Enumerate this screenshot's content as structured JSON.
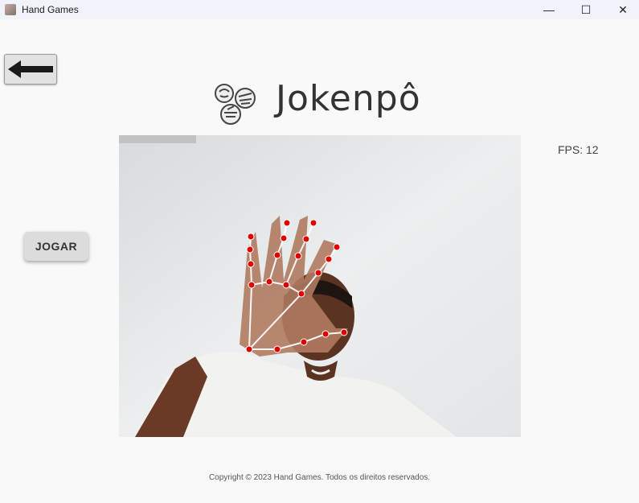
{
  "window": {
    "title": "Hand Games",
    "controls": {
      "minimize": "—",
      "maximize": "☐",
      "close": "✕"
    }
  },
  "header": {
    "title": "Jokenpô",
    "logo_icon": "rock-paper-scissors-hands-icon"
  },
  "toolbar": {
    "back_icon": "arrow-left-icon"
  },
  "stats": {
    "fps": "FPS: 12"
  },
  "controls": {
    "play_label": "JOGAR"
  },
  "camera": {
    "content": "webcam-feed-hand-tracking",
    "landmark_color": "#e00000",
    "connection_color": "#ffffff"
  },
  "footer": {
    "copyright": "Copyright © 2023 Hand Games. Todos os direitos reservados."
  }
}
